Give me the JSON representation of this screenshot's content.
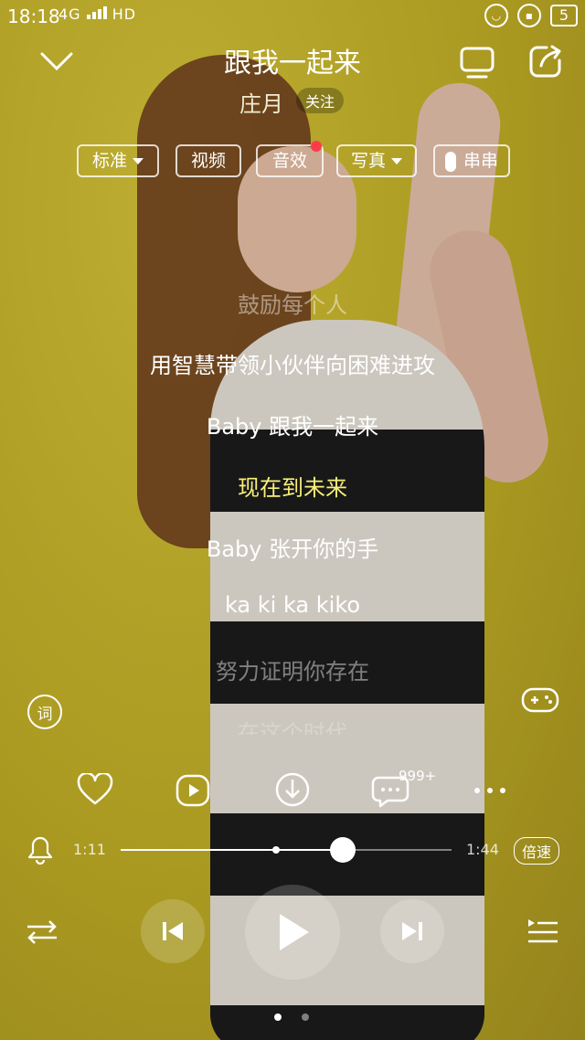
{
  "status_bar": {
    "time": "18:18",
    "signal": "4G",
    "hd": "HD",
    "battery": "5"
  },
  "song": {
    "title": "跟我一起来",
    "artist": "庄月",
    "follow_label": "关注"
  },
  "chips": [
    {
      "label": "标准",
      "dropdown": true
    },
    {
      "label": "视频",
      "dropdown": false
    },
    {
      "label": "音效",
      "dropdown": false
    },
    {
      "label": "写真",
      "dropdown": true
    },
    {
      "label": "串串",
      "dropdown": false
    }
  ],
  "lyrics": [
    {
      "text": "鼓励每个人"
    },
    {
      "text": "用智慧带领小伙伴向困难进攻"
    },
    {
      "text": "Baby 跟我一起来"
    },
    {
      "text": "现在到未来"
    },
    {
      "text": "Baby 张开你的手"
    },
    {
      "text": "ka ki ka kiko"
    },
    {
      "text": "努力证明你存在"
    },
    {
      "text": "在这个时代"
    }
  ],
  "lyrics_button": "词",
  "actions": {
    "comment_count": "999+"
  },
  "progress": {
    "current": "1:11",
    "total": "1:44",
    "fraction": 0.67,
    "buffered": 0.47,
    "speed_label": "倍速"
  },
  "pager": {
    "pages": 2,
    "active": 0
  },
  "colors": {
    "accent_lyric": "#f7ef7a",
    "notice_dot": "#ff3b4a"
  }
}
